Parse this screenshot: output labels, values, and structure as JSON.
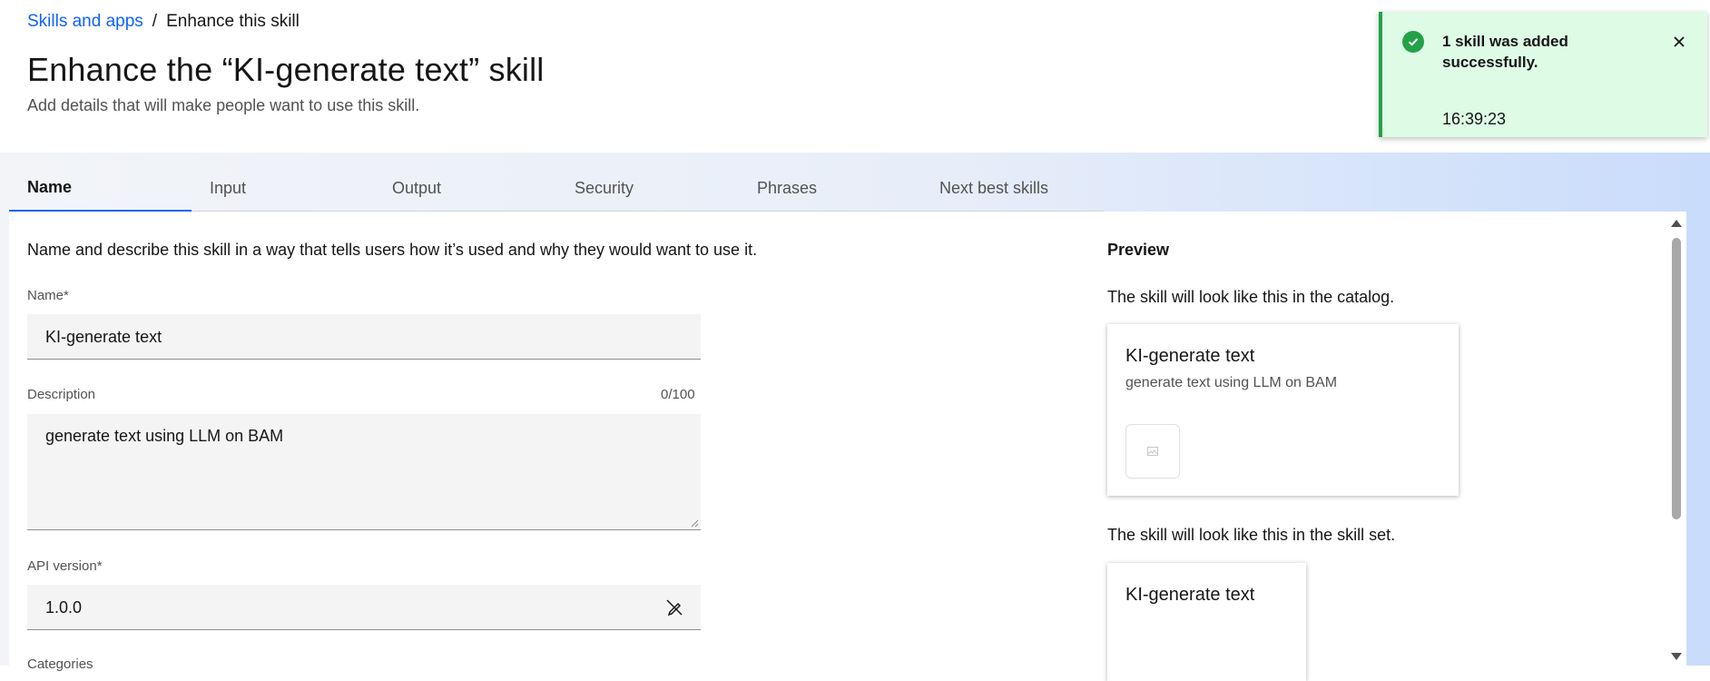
{
  "breadcrumb": {
    "parent": "Skills and apps",
    "separator": "/",
    "current": "Enhance this skill"
  },
  "page": {
    "title": "Enhance the “KI-generate text” skill",
    "subtitle": "Add details that will make people want to use this skill."
  },
  "toast": {
    "title": "1 skill was added successfully.",
    "time": "16:39:23",
    "icon": "checkmark-filled-icon",
    "close_icon": "close-icon",
    "accent": "#24a148",
    "background": "#defbe6"
  },
  "tabs": [
    {
      "label": "Name",
      "active": true
    },
    {
      "label": "Input",
      "active": false
    },
    {
      "label": "Output",
      "active": false
    },
    {
      "label": "Security",
      "active": false
    },
    {
      "label": "Phrases",
      "active": false
    },
    {
      "label": "Next best skills",
      "active": false
    }
  ],
  "form": {
    "intro": "Name and describe this skill in a way that tells users how it’s used and why they would want to use it.",
    "name": {
      "label": "Name*",
      "value": "KI-generate text"
    },
    "description": {
      "label": "Description",
      "value": "generate text using LLM on BAM",
      "counter": "0/100"
    },
    "api_version": {
      "label": "API version*",
      "value": "1.0.0",
      "icon": "edit-off-icon"
    },
    "categories": {
      "label": "Categories"
    }
  },
  "preview": {
    "title": "Preview",
    "catalog_text": "The skill will look like this in the catalog.",
    "catalog_card": {
      "title": "KI-generate text",
      "description": "generate text using LLM on BAM",
      "thumb_icon": "image-placeholder-icon"
    },
    "skillset_text": "The skill will look like this in the skill set.",
    "skillset_card": {
      "title": "KI-generate text"
    }
  },
  "colors": {
    "link": "#0f62fe",
    "tab_underline": "#0f62fe",
    "field_bg": "#f4f4f4"
  }
}
